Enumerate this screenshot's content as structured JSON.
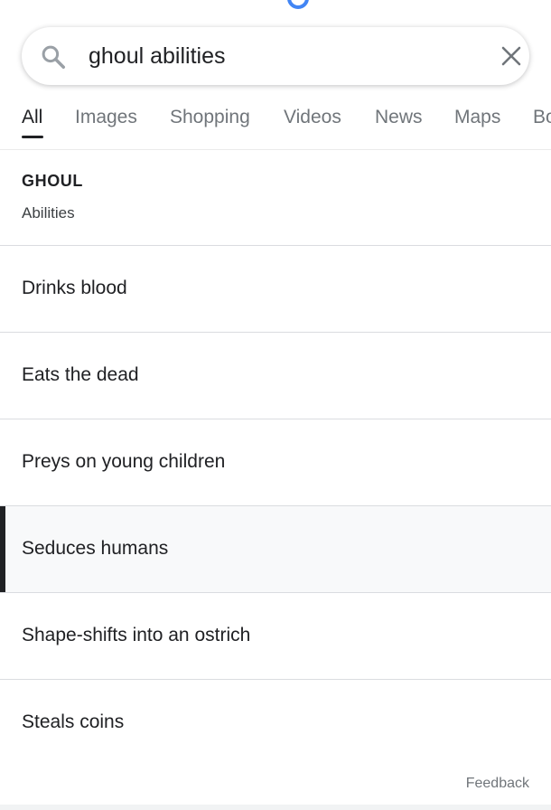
{
  "search": {
    "query": "ghoul abilities",
    "search_icon": "search-icon",
    "clear_icon": "close-icon"
  },
  "tabs": [
    {
      "label": "All",
      "active": true
    },
    {
      "label": "Images"
    },
    {
      "label": "Shopping"
    },
    {
      "label": "Videos"
    },
    {
      "label": "News"
    },
    {
      "label": "Maps"
    },
    {
      "label": "Bo"
    }
  ],
  "header": {
    "title": "GHOUL",
    "subtitle": "Abilities"
  },
  "abilities": [
    {
      "label": "Drinks blood"
    },
    {
      "label": "Eats the dead"
    },
    {
      "label": "Preys on young children"
    },
    {
      "label": "Seduces humans",
      "selected": true
    },
    {
      "label": "Shape-shifts into an ostrich"
    },
    {
      "label": "Steals coins"
    }
  ],
  "footer": {
    "feedback": "Feedback"
  },
  "colors": {
    "accent_blue": "#4285f4",
    "text_primary": "#202124",
    "text_secondary": "#70757a",
    "divider": "#dadce0"
  }
}
